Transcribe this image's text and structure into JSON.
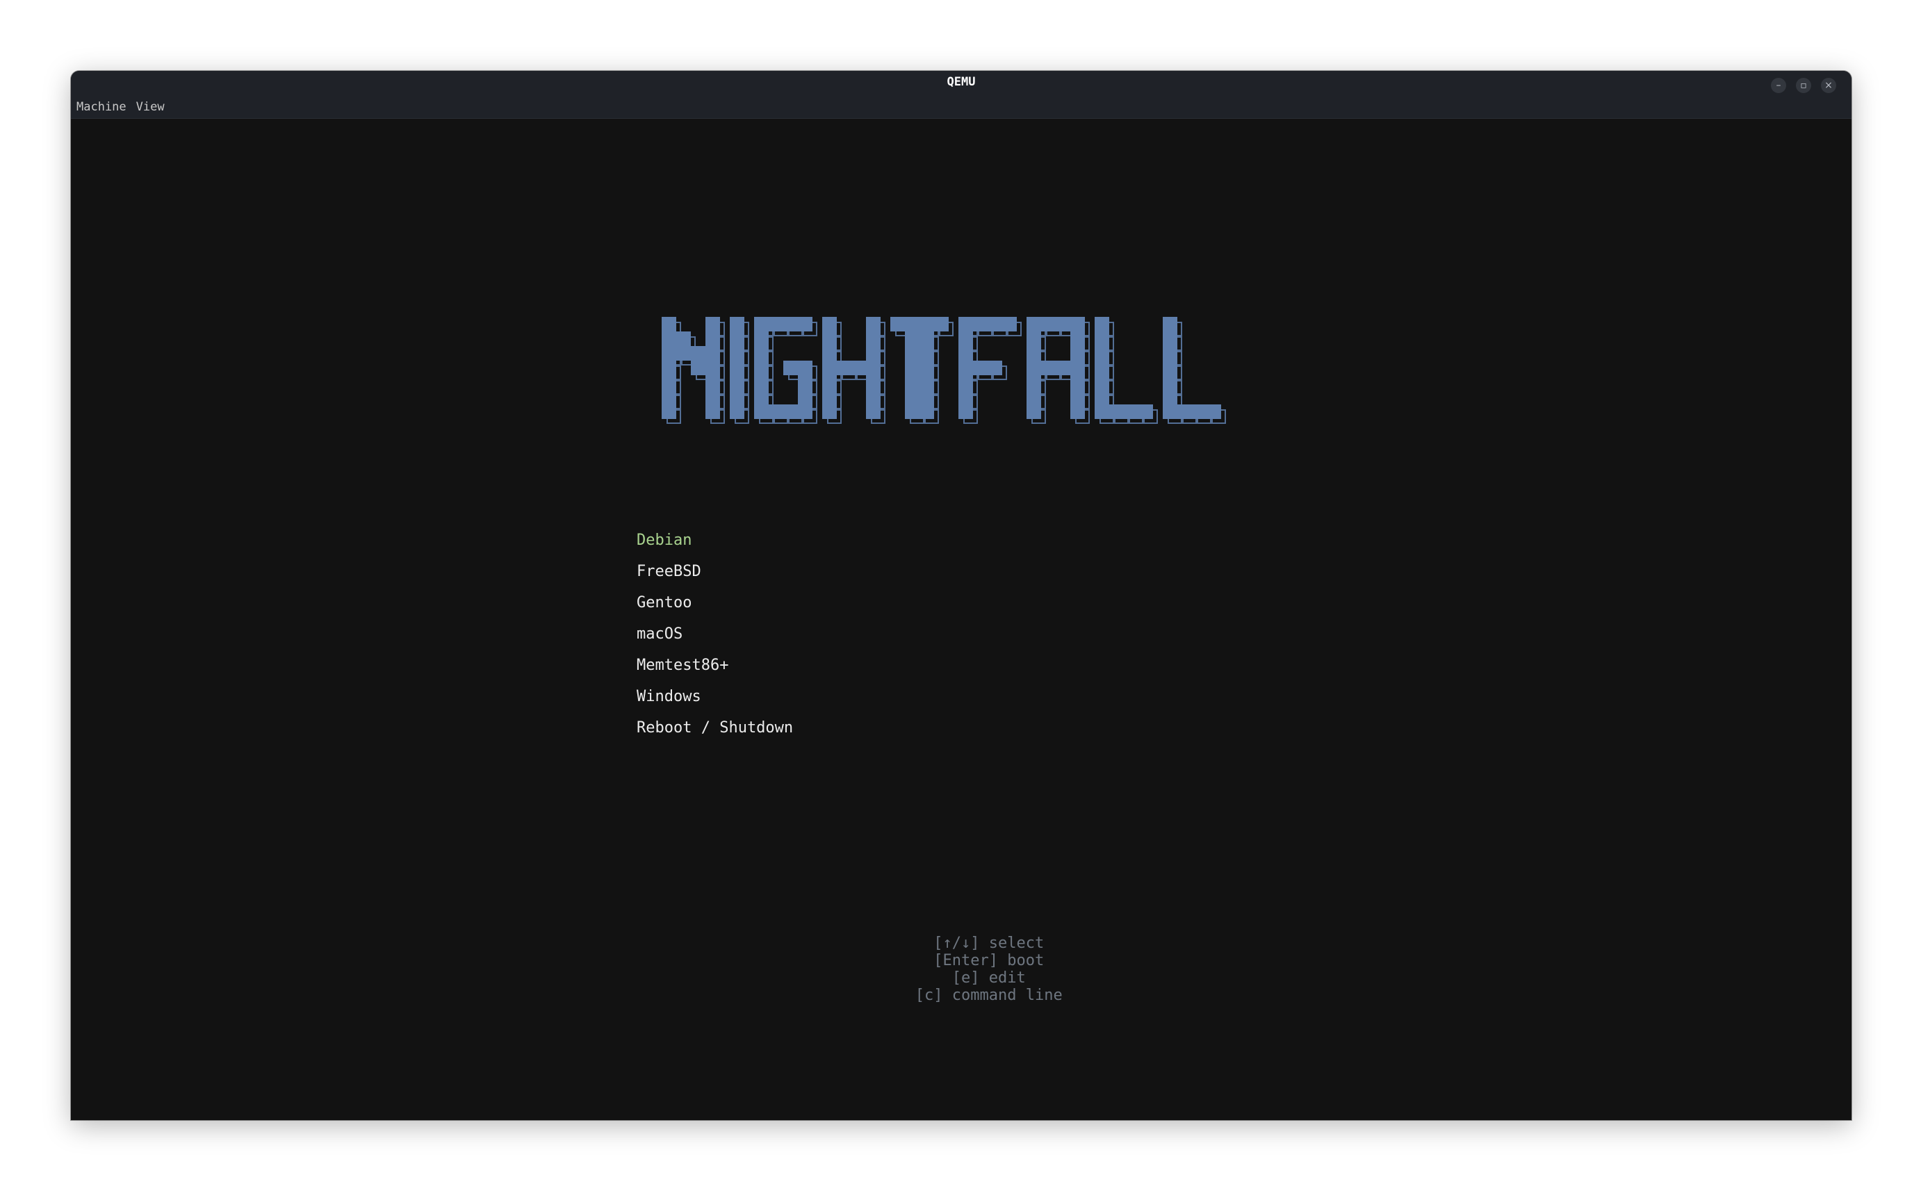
{
  "window": {
    "title": "QEMU",
    "controls": {
      "minimize_icon": "minimize-icon",
      "maximize_icon": "maximize-icon",
      "close_icon": "close-icon"
    }
  },
  "menubar": {
    "items": [
      {
        "label": "Machine"
      },
      {
        "label": "View"
      }
    ]
  },
  "boot_screen": {
    "logo_text": "NIGHTFALL",
    "logo_color": "#5f7fad",
    "entries": [
      {
        "label": "Debian",
        "selected": true
      },
      {
        "label": "FreeBSD",
        "selected": false
      },
      {
        "label": "Gentoo",
        "selected": false
      },
      {
        "label": "macOS",
        "selected": false
      },
      {
        "label": "Memtest86+",
        "selected": false
      },
      {
        "label": "Windows",
        "selected": false
      },
      {
        "label": "Reboot / Shutdown",
        "selected": false
      }
    ],
    "selected_color": "#a9d38f",
    "hints": [
      {
        "label": "[↑/↓] select"
      },
      {
        "label": "[Enter] boot"
      },
      {
        "label": "[e] edit"
      },
      {
        "label": "[c] command line"
      }
    ]
  }
}
